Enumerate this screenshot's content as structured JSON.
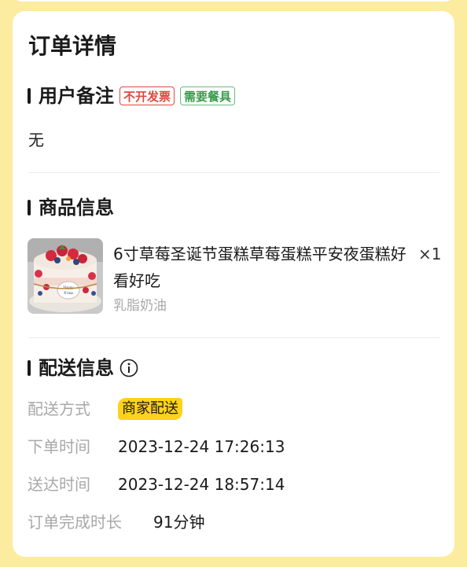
{
  "page": {
    "title": "订单详情"
  },
  "remark": {
    "title": "用户备注",
    "tags": [
      "不开发票",
      "需要餐具"
    ],
    "text": "无"
  },
  "product": {
    "section_title": "商品信息",
    "name": "6寸草莓圣诞节蛋糕草莓蛋糕平安夜蛋糕好看好吃",
    "quantity": "×1",
    "spec": "乳脂奶油",
    "thumb_caption": "Happy X'mas"
  },
  "delivery": {
    "section_title": "配送信息",
    "rows": [
      {
        "label": "配送方式",
        "value": "商家配送"
      },
      {
        "label": "下单时间",
        "value": "2023-12-24 17:26:13"
      },
      {
        "label": "送达时间",
        "value": "2023-12-24 18:57:14"
      },
      {
        "label": "订单完成时长",
        "value": "91分钟"
      }
    ]
  },
  "colors": {
    "background": "#fbeca0",
    "tag_red": "#e0483e",
    "tag_green": "#3a9b4e",
    "badge_yellow": "#ffd21c"
  }
}
